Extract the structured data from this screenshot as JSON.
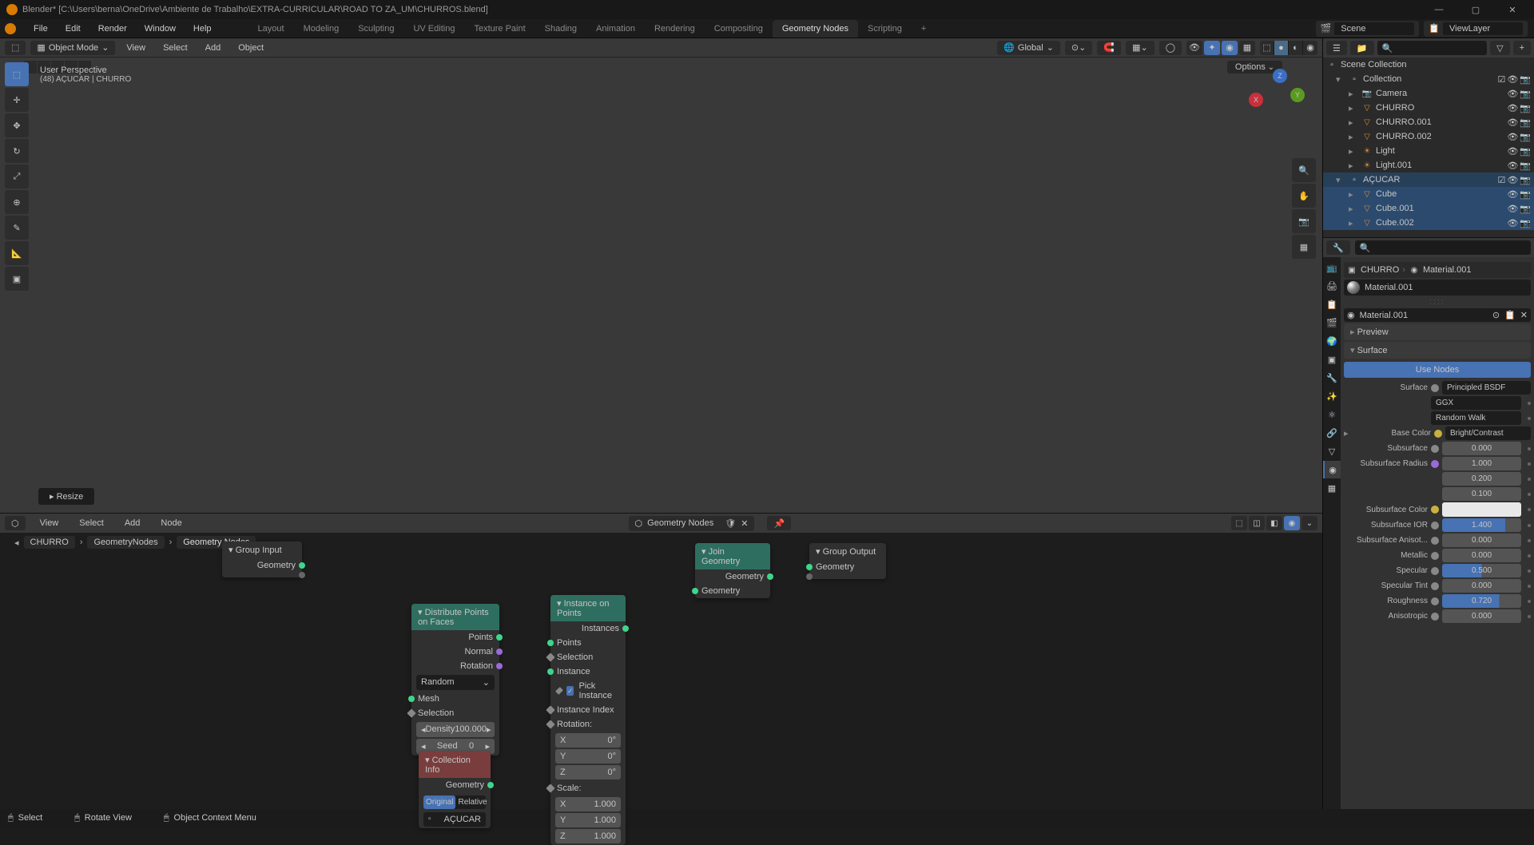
{
  "title": "Blender* [C:\\Users\\berna\\OneDrive\\Ambiente de Trabalho\\EXTRA-CURRICULAR\\ROAD TO ZA_UM\\CHURROS.blend]",
  "topmenu": [
    "File",
    "Edit",
    "Render",
    "Window",
    "Help"
  ],
  "workspaces": [
    "Layout",
    "Modeling",
    "Sculpting",
    "UV Editing",
    "Texture Paint",
    "Shading",
    "Animation",
    "Rendering",
    "Compositing",
    "Geometry Nodes",
    "Scripting"
  ],
  "workspace_active": "Geometry Nodes",
  "scene": {
    "label": "Scene",
    "viewlayer": "ViewLayer"
  },
  "viewport": {
    "mode": "Object Mode",
    "menus": [
      "View",
      "Select",
      "Add",
      "Object"
    ],
    "orientation": "Global",
    "overlay_line1": "User Perspective",
    "overlay_line2": "(48) AÇUCAR | CHURRO",
    "options": "Options",
    "resize": "Resize"
  },
  "outliner": {
    "root": "Scene Collection",
    "coll1": "Collection",
    "items1": [
      "Camera",
      "CHURRO",
      "CHURRO.001",
      "CHURRO.002",
      "Light",
      "Light.001"
    ],
    "coll2": "AÇUCAR",
    "items2": [
      "Cube",
      "Cube.001",
      "Cube.002"
    ]
  },
  "node_editor": {
    "menus": [
      "View",
      "Select",
      "Add",
      "Node"
    ],
    "treename": "Geometry Nodes",
    "breadcrumb": [
      "CHURRO",
      "GeometryNodes",
      "Geometry Nodes"
    ],
    "group_input": {
      "title": "Group Input",
      "out": "Geometry"
    },
    "group_output": {
      "title": "Group Output",
      "in": "Geometry"
    },
    "distribute": {
      "title": "Distribute Points on Faces",
      "outs": [
        "Points",
        "Normal",
        "Rotation"
      ],
      "mode": "Random",
      "ins": [
        "Mesh",
        "Selection"
      ],
      "density_label": "Density",
      "density": "100.000",
      "seed_label": "Seed",
      "seed": "0"
    },
    "instance": {
      "title": "Instance on Points",
      "out": "Instances",
      "ins": [
        "Points",
        "Selection",
        "Instance",
        "Pick Instance",
        "Instance Index",
        "Rotation:",
        "Scale:"
      ],
      "rot": {
        "x": "0°",
        "y": "0°",
        "z": "0°"
      },
      "scale": {
        "x": "1.000",
        "y": "1.000",
        "z": "1.000"
      }
    },
    "join": {
      "title": "Join Geometry",
      "out": "Geometry",
      "in": "Geometry"
    },
    "collinfo": {
      "title": "Collection Info",
      "out": "Geometry",
      "tabs": [
        "Original",
        "Relative"
      ],
      "coll": "AÇUCAR"
    }
  },
  "properties": {
    "active_object": "CHURRO",
    "active_material": "Material.001",
    "material_slot": "Material.001",
    "material_name": "Material.001",
    "preview": "Preview",
    "surface_panel": "Surface",
    "use_nodes": "Use Nodes",
    "surface_label": "Surface",
    "surface_value": "Principled BSDF",
    "distribution": "GGX",
    "subsurf_method": "Random Walk",
    "basecolor_label": "Base Color",
    "basecolor_value": "Bright/Contrast",
    "subsurface_label": "Subsurface",
    "subsurface": "0.000",
    "subsurf_radius_label": "Subsurface Radius",
    "subsurf_radius": [
      "1.000",
      "0.200",
      "0.100"
    ],
    "subsurf_color_label": "Subsurface Color",
    "subsurf_ior_label": "Subsurface IOR",
    "subsurf_ior": "1.400",
    "subsurf_aniso_label": "Subsurface Anisot...",
    "subsurf_aniso": "0.000",
    "metallic_label": "Metallic",
    "metallic": "0.000",
    "specular_label": "Specular",
    "specular": "0.500",
    "spectint_label": "Specular Tint",
    "spectint": "0.000",
    "roughness_label": "Roughness",
    "roughness": "0.720",
    "aniso_label": "Anisotropic",
    "aniso": "0.000"
  },
  "status": {
    "select": "Select",
    "rotate": "Rotate View",
    "context": "Object Context Menu"
  }
}
